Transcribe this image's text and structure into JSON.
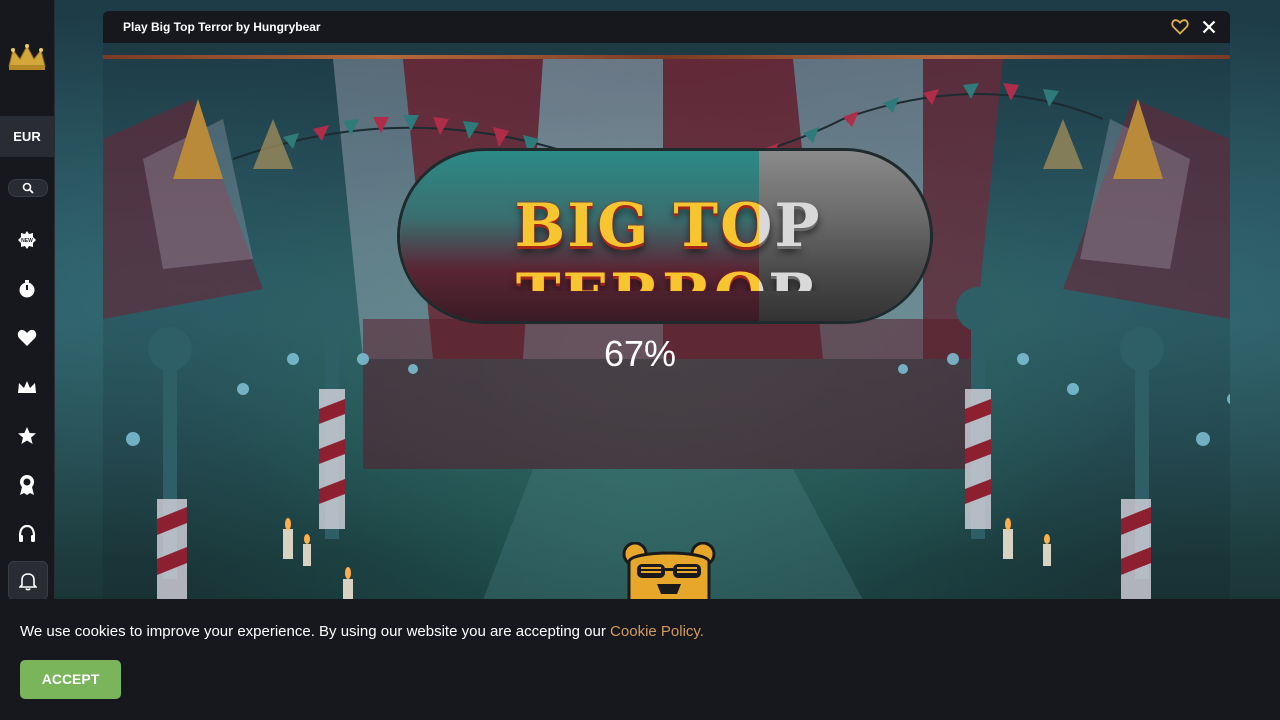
{
  "sidebar": {
    "currency": "EUR",
    "icons": [
      "new-games-icon",
      "stopwatch-icon",
      "heart-icon",
      "crown-icon",
      "star-icon",
      "badge-icon",
      "headset-icon",
      "bell-icon"
    ]
  },
  "game_window": {
    "title": "Play Big Top Terror by Hungrybear",
    "logo_text": "BIG TOP TERROR",
    "loading_percent": "67%",
    "loading_progress": 0.67
  },
  "cookie_banner": {
    "text": "We use cookies to improve your experience. By using our website you are accepting our ",
    "link_text": "Cookie Policy.",
    "accept_label": "ACCEPT"
  },
  "colors": {
    "accent_gold": "#e0b04a",
    "accept_green": "#7ab55c",
    "link_orange": "#d39b5c",
    "dark": "#17181d"
  }
}
